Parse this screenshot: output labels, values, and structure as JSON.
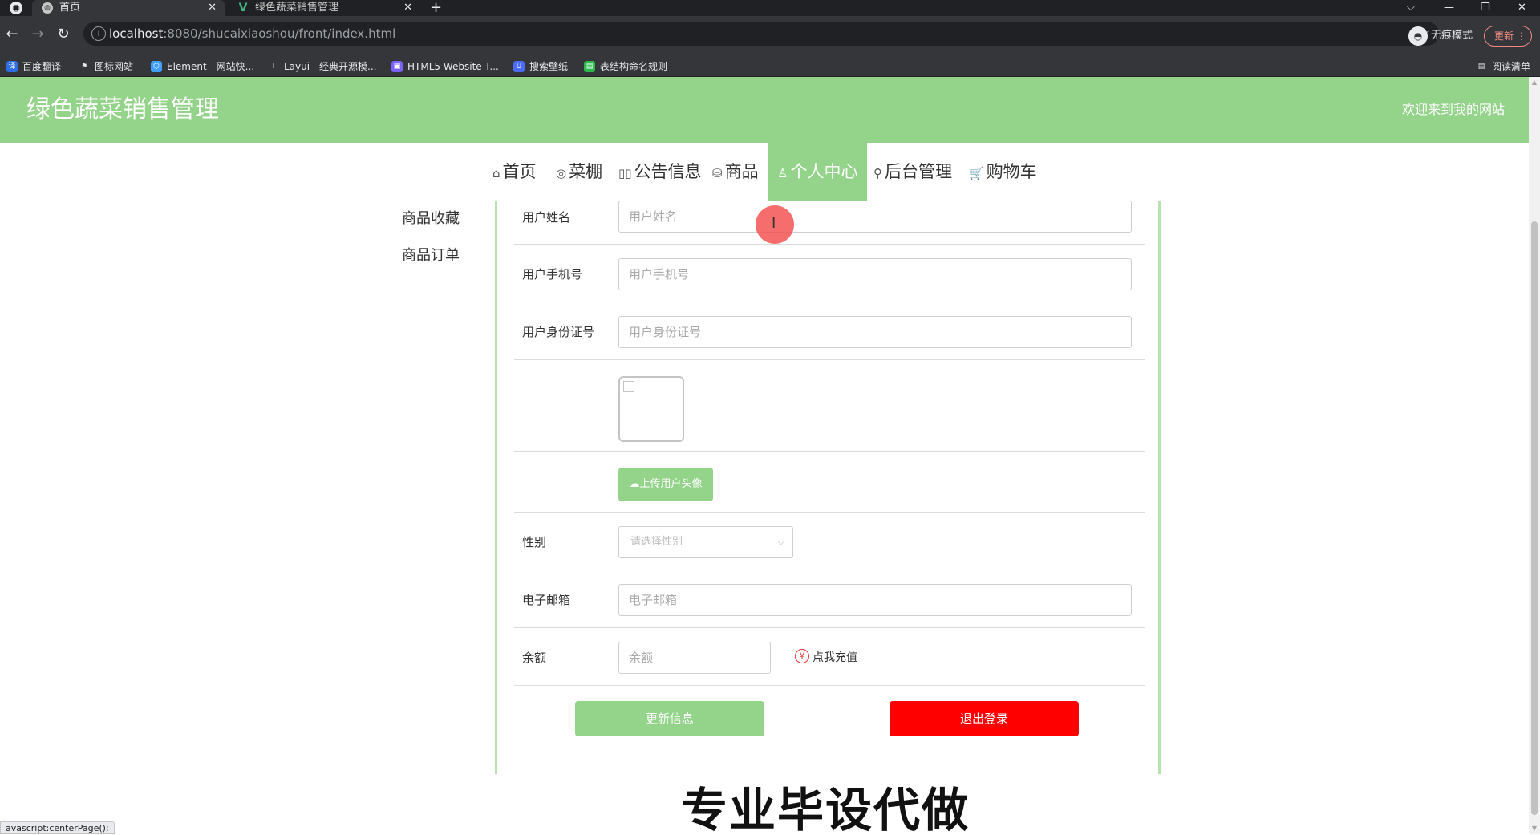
{
  "browser": {
    "tabs": [
      {
        "title": "首页",
        "active": true
      },
      {
        "title": "绿色蔬菜销售管理",
        "active": false
      }
    ],
    "new_tab": "+",
    "tab_close": "✕",
    "window_controls": {
      "dropdown": "⌵",
      "minimize": "—",
      "restore": "❐",
      "close": "✕"
    },
    "url_host": "localhost",
    "url_rest": ":8080/shucaixiaoshou/front/index.html",
    "incognito_label": "无痕模式",
    "update_label": "更新",
    "bookmarks": [
      "百度翻译",
      "图标网站",
      "Element - 网站快...",
      "Layui - 经典开源模...",
      "HTML5 Website T...",
      "搜索壁纸",
      "表结构命名规则"
    ],
    "reading_list": "阅读清单"
  },
  "site": {
    "title": "绿色蔬菜销售管理",
    "welcome": "欢迎来到我的网站",
    "nav": [
      {
        "label": "首页",
        "icon": "⌂"
      },
      {
        "label": "菜棚",
        "icon": "◎"
      },
      {
        "label": "公告信息",
        "icon": "▯▯"
      },
      {
        "label": "商品",
        "icon": "⛁"
      },
      {
        "label": "个人中心",
        "icon": "♙",
        "active": true
      },
      {
        "label": "后台管理",
        "icon": "⚲"
      },
      {
        "label": "购物车",
        "icon": "🛒"
      }
    ],
    "side_menu": [
      "商品收藏",
      "商品订单"
    ]
  },
  "form": {
    "username": {
      "label": "用户姓名",
      "placeholder": "用户姓名"
    },
    "phone": {
      "label": "用户手机号",
      "placeholder": "用户手机号"
    },
    "idcard": {
      "label": "用户身份证号",
      "placeholder": "用户身份证号"
    },
    "upload_label": "上传用户头像",
    "gender": {
      "label": "性别",
      "placeholder": "请选择性别"
    },
    "email": {
      "label": "电子邮箱",
      "placeholder": "电子邮箱"
    },
    "balance": {
      "label": "余额",
      "placeholder": "余额",
      "recharge": "点我充值"
    },
    "update_button": "更新信息",
    "logout_button": "退出登录"
  },
  "overlay": {
    "watermark": "专业毕设代做",
    "status_tip": "avascript:centerPage();"
  },
  "colors": {
    "header_green": "#94d38a",
    "logout_red": "#ff0000",
    "border_green": "#b6e3b0"
  }
}
